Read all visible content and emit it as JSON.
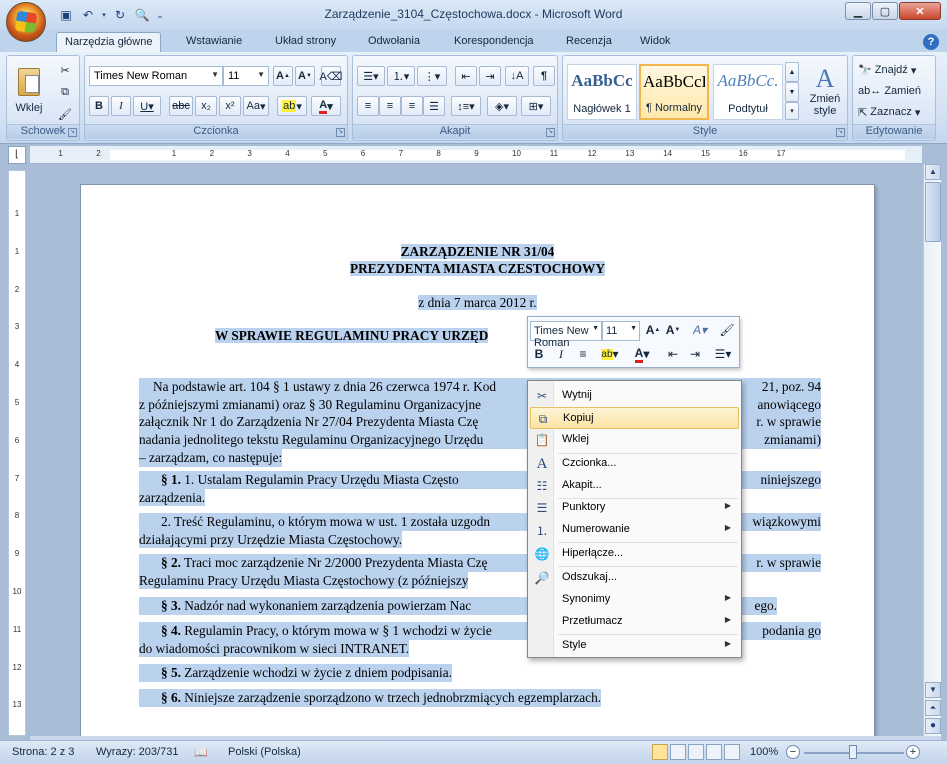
{
  "window": {
    "title": "Zarządzenie_3104_Częstochowa.docx - Microsoft Word"
  },
  "tabs": [
    "Narzędzia główne",
    "Wstawianie",
    "Układ strony",
    "Odwołania",
    "Korespondencja",
    "Recenzja",
    "Widok"
  ],
  "ribbon": {
    "clipboard": {
      "paste": "Wklej",
      "group": "Schowek"
    },
    "font": {
      "name": "Times New Roman",
      "size": "11",
      "group": "Czcionka",
      "aa_label": "Aa"
    },
    "paragraph": {
      "group": "Akapit"
    },
    "styles": {
      "group": "Style",
      "items": [
        {
          "sample": "AaBbCc",
          "name": "Nagłówek 1"
        },
        {
          "sample": "AaBbCcD",
          "name": "¶ Normalny"
        },
        {
          "sample": "AaBbCc.",
          "name": "Podtytuł"
        }
      ],
      "change": "Zmień style"
    },
    "editing": {
      "group": "Edytowanie",
      "find": "Znajdź",
      "replace": "Zamień",
      "select": "Zaznacz"
    }
  },
  "document": {
    "title1": "ZARZĄDZENIE NR 31/04",
    "title2": "PREZYDENTA MIASTA CZESTOCHOWY",
    "date": "z dnia 7 marca 2012 r.",
    "subject": "W SPRAWIE REGULAMINU PRACY URZĘD",
    "p1": [
      "Na podstawie art. 104 § 1 ustawy z dnia 26 czerwca 1974 r. Kod",
      "z późniejszymi zmianami) oraz § 30 Regulaminu Organizacyjne",
      "załącznik Nr 1 do Zarządzenia Nr 27/04 Prezydenta Miasta Czę",
      "nadania jednolitego tekstu Regulaminu Organizacyjnego Urzędu",
      "– zarządzam, co następuje:"
    ],
    "p1_right": [
      "21, poz. 94",
      "anowiącego",
      "r. w sprawie",
      "zmianami)"
    ],
    "s1": {
      "mark": "§ 1.",
      "l1": "1. Ustalam Regulamin Pracy Urzędu Miasta Często",
      "l1r": "niniejszego",
      "l2": "zarządzenia."
    },
    "s1b": {
      "l1": "2. Treść Regulaminu, o którym mowa w ust. 1 została uzgodn",
      "l1r": "wiązkowymi",
      "l2": "działającymi przy Urzędzie Miasta Częstochowy."
    },
    "s2": {
      "mark": "§ 2.",
      "l1": "Traci moc zarządzenie Nr 2/2000 Prezydenta Miasta Czę",
      "l1r": "r. w sprawie",
      "l2": "Regulaminu Pracy Urzędu Miasta Częstochowy (z późniejszy"
    },
    "s3": {
      "mark": "§ 3.",
      "l1": "Nadzór nad wykonaniem zarządzenia powierzam Nac",
      "l1r": "ego."
    },
    "s4": {
      "mark": "§ 4.",
      "l1": "Regulamin Pracy, o którym mowa w § 1 wchodzi w życie",
      "l1r": "podania go",
      "l2": "do wiadomości pracownikom w sieci INTRANET."
    },
    "s5": {
      "mark": "§ 5.",
      "l1": "Zarządzenie wchodzi w życie z dniem podpisania."
    },
    "s6": {
      "mark": "§ 6.",
      "l1": "Niniejsze zarządzenie sporządzono w trzech jednobrzmiących egzemplarzach."
    }
  },
  "minitoolbar": {
    "font": "Times New Roman",
    "size": "11"
  },
  "context_menu": [
    {
      "label": "Wytnij",
      "icon": "scissors-icon"
    },
    {
      "label": "Kopiuj",
      "icon": "copy-icon"
    },
    {
      "label": "Wklej",
      "icon": "paste-icon"
    },
    {
      "label": "Czcionka...",
      "icon": "font-icon"
    },
    {
      "label": "Akapit...",
      "icon": "paragraph-icon"
    },
    {
      "label": "Punktory",
      "icon": "bullets-icon"
    },
    {
      "label": "Numerowanie",
      "icon": "numbering-icon"
    },
    {
      "label": "Hiperłącze...",
      "icon": "hyperlink-icon"
    },
    {
      "label": "Odszukaj...",
      "icon": "research-icon"
    },
    {
      "label": "Synonimy",
      "icon": ""
    },
    {
      "label": "Przetłumacz",
      "icon": ""
    },
    {
      "label": "Style",
      "icon": ""
    }
  ],
  "status": {
    "page": "Strona: 2 z 3",
    "words": "Wyrazy: 203/731",
    "language": "Polski (Polska)",
    "zoom": "100%"
  },
  "ruler_numbers": [
    "1",
    "2",
    "1",
    "2",
    "3",
    "4",
    "5",
    "6",
    "7",
    "8",
    "9",
    "10",
    "11",
    "12",
    "13",
    "14",
    "15",
    "16",
    "17"
  ],
  "vruler_numbers": [
    "1",
    "1",
    "2",
    "3",
    "4",
    "5",
    "6",
    "7",
    "8",
    "9",
    "10",
    "11",
    "12",
    "13"
  ]
}
